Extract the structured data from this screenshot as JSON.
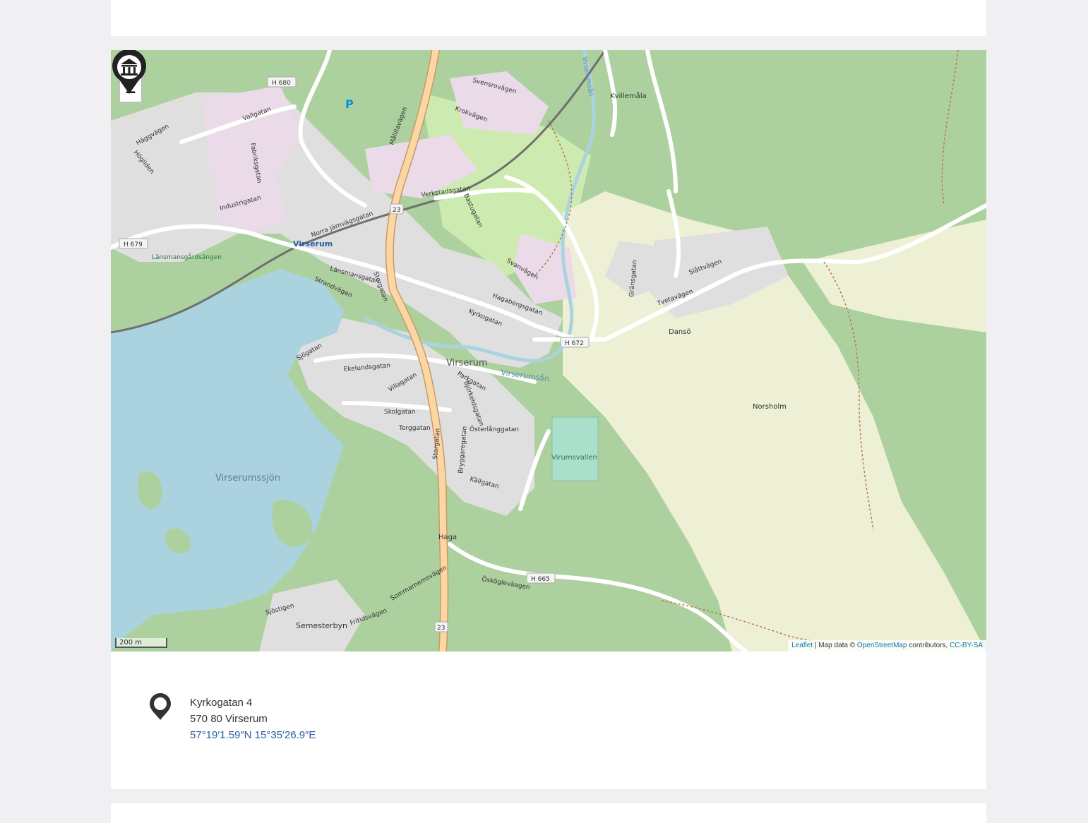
{
  "map": {
    "zoom_in_label": "+",
    "zoom_out_label": "−",
    "scale_label": "200 m",
    "attribution": {
      "leaflet": "Leaflet",
      "separator": " | Map data © ",
      "osm": "OpenStreetMap",
      "contributors": " contributors, ",
      "license": "CC-BY-SA"
    },
    "labels": {
      "town": "Virserum",
      "lake": "Virserumssjön",
      "river": "Virserumsån",
      "river_east": "Virserumsån",
      "kvillemala": "Kvillemåla",
      "norsholm": "Norsholm",
      "danso": "Dansö",
      "haga": "Haga",
      "semesterbyn": "Semesterbyn",
      "virumsvallen": "Virumsvallen",
      "lansmansgardsangen": "Länsmansgårdsängen",
      "virserum_station": "Virserum",
      "malilla": "Målillavägen",
      "storgatan": "Storgatan",
      "storgatan_south": "Storgatan",
      "kyrkogatan": "Kyrkogatan",
      "tvetavagen": "Tvetavägen",
      "oskoglevagen": "Öskögleväagen",
      "strandvagen": "Strandvägen",
      "ekelundsgatan": "Ekelundsgatan",
      "skolgatan": "Skolgatan",
      "torggatan": "Torggatan",
      "osterlanggatan": "Österlånggatan",
      "kallgatan": "Källgatan",
      "svensrovagen": "Svensrovägen",
      "krokvagen": "Krokvägen",
      "verkstadsgatan": "Verkstadsgatan",
      "vallgatan": "Vallgatan",
      "industrigatan": "Industrigatan",
      "fabriksgatan": "Fabriksgatan",
      "norra_jarnvagsgatan": "Norra Järnvägsgatan",
      "lansmansgatan": "Länsmansgatan",
      "bastugatan": "Bastugatan",
      "sjogatan": "Sjögatan",
      "parkgatan": "Parkgatan",
      "villagatan": "Villagatan",
      "bryggaregatan": "Bryggaregatan",
      "gransgatan": "Gränsgatan",
      "slattvagen": "Slåttvägen",
      "sommarnemsvagen": "Sommarnemsvägen",
      "fritidsvagen": "Fritidsvägen",
      "haggvagen": "Häggvägen",
      "hogliden": "Högliden",
      "sjostigen": "Sjöstigen",
      "bjorkeldsgatan": "Björkeldsgatan",
      "hagabergsgatan": "Hagabergsgatan",
      "svanvagen": "Svanvägen",
      "parking": "P"
    },
    "shields": {
      "h680": "H 680",
      "h679": "H 679",
      "h672": "H 672",
      "h665": "H 665",
      "r23_north": "23",
      "r23_south": "23"
    }
  },
  "address": {
    "street": "Kyrkogatan 4",
    "postal": "570 80 Virserum",
    "coordinates": "57°19′1.59″N 15°35′26.9″E"
  },
  "colors": {
    "forest": "#add19e",
    "meadow": "#cdebb0",
    "farmland": "#eef0d5",
    "water": "#aad3df",
    "residential": "#e0dfdf",
    "industrial": "#ebdbe8",
    "primary_road": "#fcd6a4",
    "road": "#ffffff",
    "rail": "#707070",
    "link": "#2a5d9f"
  }
}
